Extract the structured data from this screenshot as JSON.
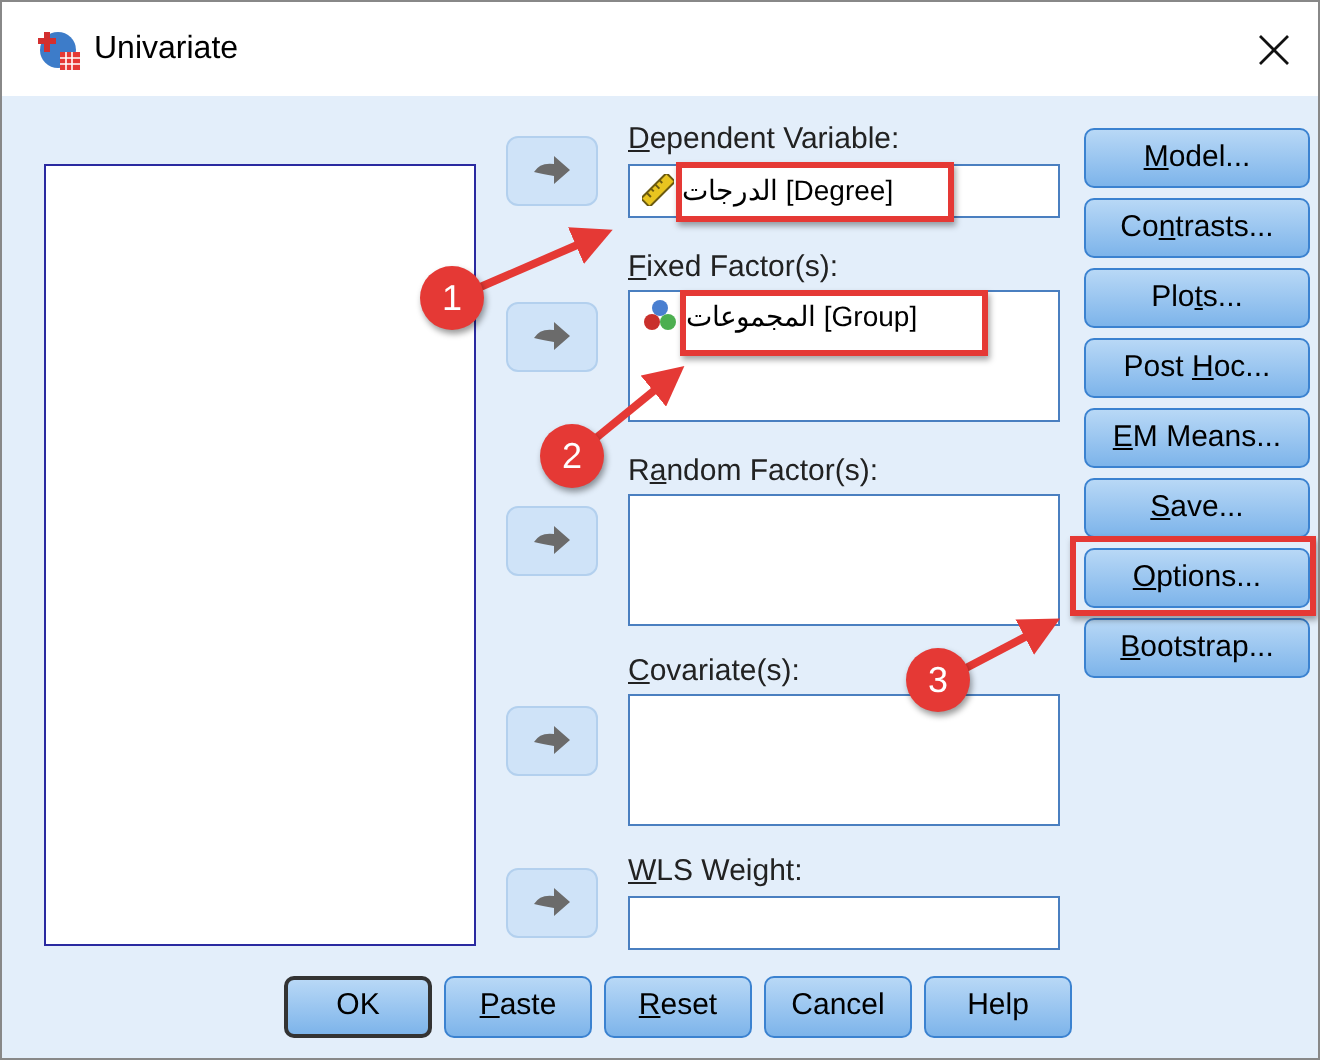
{
  "window": {
    "title": "Univariate"
  },
  "targets": [
    {
      "kind": "single",
      "label": {
        "key": "D",
        "after": "ependent Variable:"
      },
      "items": [
        {
          "kind": "scale",
          "text": "الدرجات [Degree]"
        }
      ]
    },
    {
      "kind": "list",
      "label": {
        "key": "F",
        "after": "ixed Factor(s):"
      },
      "items": [
        {
          "kind": "nominal",
          "text": "المجموعات [Group]"
        }
      ]
    },
    {
      "kind": "list",
      "label": {
        "before": "R",
        "key": "a",
        "after": "ndom Factor(s):"
      }
    },
    {
      "kind": "list",
      "label": {
        "key": "C",
        "after": "ovariate(s):"
      }
    },
    {
      "kind": "single",
      "label": {
        "key": "W",
        "after": "LS Weight:"
      }
    }
  ],
  "side_buttons": [
    {
      "label": {
        "key": "M",
        "after": "odel..."
      }
    },
    {
      "label": {
        "before": "Co",
        "key": "n",
        "after": "trasts..."
      }
    },
    {
      "label": {
        "before": "Plo",
        "key": "t",
        "after": "s..."
      }
    },
    {
      "label": {
        "before": "Post ",
        "key": "H",
        "after": "oc..."
      }
    },
    {
      "label": {
        "key": "E",
        "after": "M Means..."
      }
    },
    {
      "label": {
        "key": "S",
        "after": "ave..."
      }
    },
    {
      "label": {
        "key": "O",
        "after": "ptions..."
      }
    },
    {
      "label": {
        "key": "B",
        "after": "ootstrap..."
      }
    }
  ],
  "bottom_buttons": [
    {
      "label": {
        "text": "OK"
      },
      "default": true
    },
    {
      "label": {
        "key": "P",
        "after": "aste"
      },
      "default": false
    },
    {
      "label": {
        "key": "R",
        "after": "eset"
      },
      "default": false
    },
    {
      "label": {
        "text": "Cancel"
      },
      "default": false
    },
    {
      "label": {
        "text": "Help"
      },
      "default": false
    }
  ],
  "annotations": [
    {
      "number": "1"
    },
    {
      "number": "2"
    },
    {
      "number": "3"
    }
  ]
}
